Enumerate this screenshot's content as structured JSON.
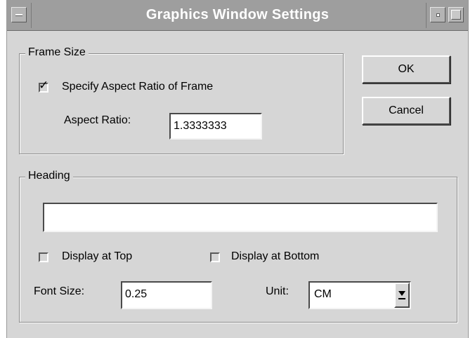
{
  "window": {
    "title": "Graphics Window Settings"
  },
  "frame_size": {
    "legend": "Frame Size",
    "specify_aspect_label": "Specify Aspect Ratio of Frame",
    "specify_aspect_checked": true,
    "aspect_ratio_label": "Aspect Ratio:",
    "aspect_ratio_value": "1.3333333"
  },
  "buttons": {
    "ok": "OK",
    "cancel": "Cancel"
  },
  "heading": {
    "legend": "Heading",
    "text_value": "",
    "display_top_label": "Display at Top",
    "display_top_checked": false,
    "display_bottom_label": "Display at Bottom",
    "display_bottom_checked": false,
    "font_size_label": "Font Size:",
    "font_size_value": "0.25",
    "unit_label": "Unit:",
    "unit_value": "CM"
  },
  "colors": {
    "window_bg": "#d6d6d6",
    "titlebar_bg": "#9e9e9e",
    "title_text": "#ffffff"
  },
  "icons": [
    "window-menu-icon",
    "minimize-icon",
    "maximize-icon",
    "checkmark-icon",
    "dropdown-arrow-icon"
  ]
}
